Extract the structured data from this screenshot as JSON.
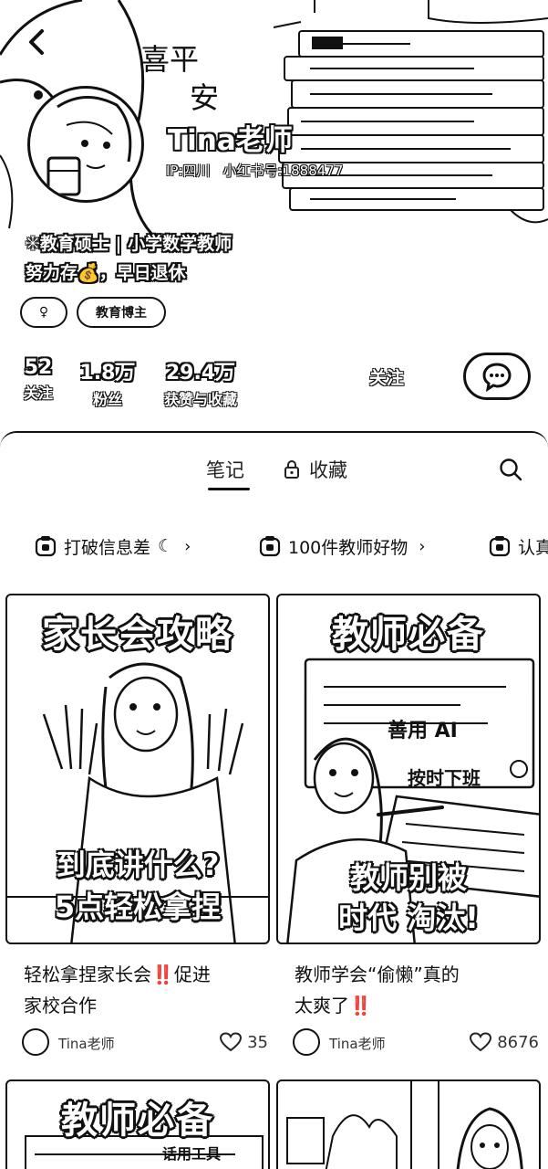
{
  "header": {
    "user_name": "Tina老师",
    "ip_location": "IP:四川",
    "xhs_id": "小红书号:1888477",
    "bio_line1": "✳教育硕士 | 小学数学教师",
    "bio_line2": "努力存💰，早日退休",
    "banner_text_1": "喜平",
    "banner_text_2": "安",
    "tags": {
      "gender": "♀",
      "education": "教育博主"
    },
    "stats": [
      {
        "num": "52",
        "label": "关注"
      },
      {
        "num": "1.8万",
        "label": "粉丝"
      },
      {
        "num": "29.4万",
        "label": "获赞与收藏"
      }
    ],
    "follow_label": "关注"
  },
  "tabs": {
    "notes": "笔记",
    "favorites": "收藏"
  },
  "collections": [
    {
      "label": "打破信息差",
      "suffix": "☾"
    },
    {
      "label": "100件教师好物",
      "suffix": ""
    },
    {
      "label": "认真",
      "suffix": ""
    }
  ],
  "notes": [
    {
      "cover_title": "家长会攻略",
      "cover_sub1": "到底讲什么?",
      "cover_sub2": "5点轻松拿捏",
      "title": "轻松拿捏家长会‼️促进家校合作",
      "title_line1": "轻松拿捏家长会‼️促进",
      "title_line2": "家校合作",
      "author": "Tina老师",
      "likes": "35"
    },
    {
      "cover_title": "教师必备",
      "cover_tag1": "善用 AI",
      "cover_tag2": "按时下班",
      "cover_sub1": "教师别被",
      "cover_sub2": "时代 淘汰!",
      "title_line1": "教师学会“偷懒”真的",
      "title_line2": "太爽了‼️",
      "author": "Tina老师",
      "likes": "8676"
    },
    {
      "cover_title": "教师必备",
      "cover_tag1": "话用工具"
    }
  ]
}
